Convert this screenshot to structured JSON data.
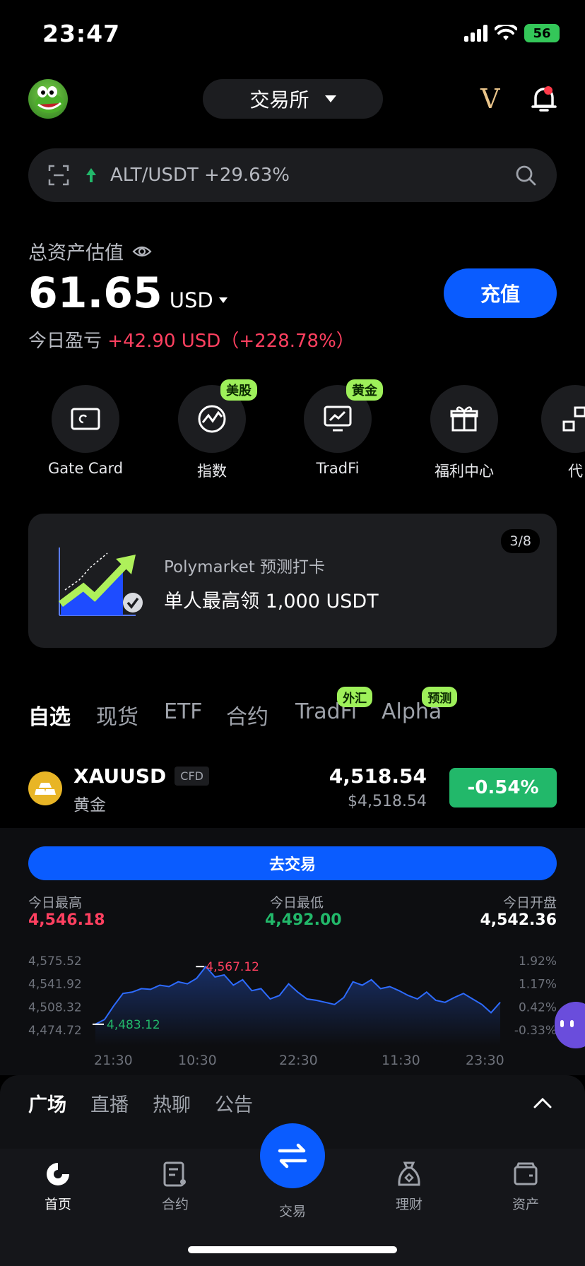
{
  "status_bar": {
    "time": "23:47",
    "battery": "56"
  },
  "header": {
    "exchange_label": "交易所",
    "vip": "V"
  },
  "search": {
    "ticker_text": "ALT/USDT +29.63%"
  },
  "assets": {
    "label": "总资产估值",
    "value": "61.65",
    "currency": "USD",
    "pnl_label": "今日盈亏",
    "pnl_value": "+42.90 USD（+228.78%）",
    "deposit_label": "充值"
  },
  "quick_actions": [
    {
      "label": "Gate Card",
      "badge": ""
    },
    {
      "label": "指数",
      "badge": "美股"
    },
    {
      "label": "TradFi",
      "badge": "黄金"
    },
    {
      "label": "福利中心",
      "badge": ""
    },
    {
      "label": "代",
      "badge": ""
    }
  ],
  "banner": {
    "subtitle": "Polymarket 预测打卡",
    "title": "单人最高领 1,000 USDT",
    "page": "3/8"
  },
  "market_tabs": [
    {
      "label": "自选",
      "badge": ""
    },
    {
      "label": "现货",
      "badge": ""
    },
    {
      "label": "ETF",
      "badge": ""
    },
    {
      "label": "合约",
      "badge": ""
    },
    {
      "label": "TradFi",
      "badge": "外汇"
    },
    {
      "label": "Alpha",
      "badge": "预测"
    }
  ],
  "market_row": {
    "symbol": "XAUUSD",
    "tag": "CFD",
    "name": "黄金",
    "price": "4,518.54",
    "price_usd": "$4,518.54",
    "change": "-0.54%",
    "colors": {
      "up": "#22b86a",
      "down": "#ff4060"
    }
  },
  "detail": {
    "trade_button": "去交易",
    "high_label": "今日最高",
    "high_value": "4,546.18",
    "low_label": "今日最低",
    "low_value": "4,492.00",
    "open_label": "今日开盘",
    "open_value": "4,542.36"
  },
  "chart_data": {
    "type": "line",
    "x_ticks": [
      "21:30",
      "10:30",
      "22:30",
      "11:30",
      "23:30"
    ],
    "y_ticks_left": [
      "4,575.52",
      "4,541.92",
      "4,508.32",
      "4,474.72"
    ],
    "y_ticks_right": [
      "1.92%",
      "1.17%",
      "0.42%",
      "-0.33%"
    ],
    "ylim": [
      4474.72,
      4575.52
    ],
    "max_label": "4,567.12",
    "min_label": "4,483.12",
    "values": [
      4483.12,
      4490,
      4510,
      4528,
      4530,
      4535,
      4534,
      4540,
      4538,
      4545,
      4542,
      4550,
      4567.12,
      4552,
      4555,
      4540,
      4548,
      4532,
      4535,
      4520,
      4525,
      4542,
      4530,
      4520,
      4518,
      4515,
      4512,
      4522,
      4545,
      4540,
      4548,
      4535,
      4538,
      4532,
      4525,
      4520,
      4530,
      4518,
      4515,
      4522,
      4528,
      4520,
      4512,
      4500,
      4515
    ],
    "line_color": "#2d6bff"
  },
  "community_tabs": [
    "广场",
    "直播",
    "热聊",
    "公告"
  ],
  "bottom_nav": [
    "首页",
    "合约",
    "交易",
    "理财",
    "资产"
  ]
}
